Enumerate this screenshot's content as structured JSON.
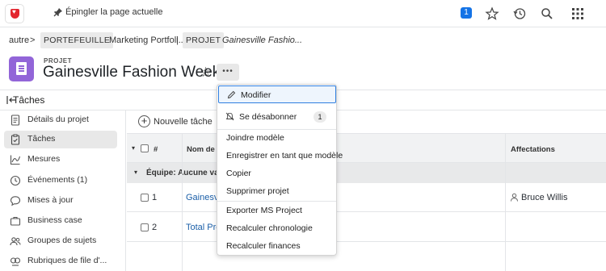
{
  "topbar": {
    "pin_label": "Épingler la page actuelle",
    "notification_count": "1"
  },
  "breadcrumb": {
    "root": "autre",
    "sep1": ">",
    "portfolio_tag": "PORTEFEUILLE",
    "portfolio_name": "Marketing Portfoli...",
    "sep2": "|",
    "project_tag": "PROJET",
    "project_name": "Gainesville Fashio..."
  },
  "header": {
    "type_label": "PROJET",
    "title": "Gainesville Fashion Week",
    "more_label": "•••"
  },
  "tasks_bar": {
    "label": "Tâches"
  },
  "sidebar": {
    "items": [
      {
        "label": "Détails du projet",
        "icon": "document-icon"
      },
      {
        "label": "Tâches",
        "icon": "clipboard-icon",
        "active": true
      },
      {
        "label": "Mesures",
        "icon": "chart-icon"
      },
      {
        "label": "Événements (1)",
        "icon": "clock-icon"
      },
      {
        "label": "Mises à jour",
        "icon": "chat-icon"
      },
      {
        "label": "Business case",
        "icon": "briefcase-icon"
      },
      {
        "label": "Groupes de sujets",
        "icon": "people-icon"
      },
      {
        "label": "Rubriques de file d'...",
        "icon": "queue-icon"
      }
    ]
  },
  "main": {
    "new_task": "Nouvelle tâche",
    "columns": {
      "num": "#",
      "name": "Nom de l",
      "assign": "Affectations"
    },
    "group_label": "Équipe: Aucune vale",
    "rows": [
      {
        "num": "1",
        "name": "Gainesvil",
        "assignee": "Bruce Willis"
      },
      {
        "num": "2",
        "name": "Total Proj",
        "assignee": ""
      }
    ]
  },
  "menu": {
    "items": [
      {
        "label": "Modifier",
        "icon": "pencil-icon"
      },
      {
        "label": "Se désabonner",
        "icon": "bell-icon",
        "count": "1"
      },
      {
        "label": "Joindre modèle"
      },
      {
        "label": "Enregistrer en tant que modèle"
      },
      {
        "label": "Copier"
      },
      {
        "label": "Supprimer projet"
      },
      {
        "label": "Exporter MS Project"
      },
      {
        "label": "Recalculer chronologie"
      },
      {
        "label": "Recalculer finances"
      }
    ]
  },
  "colors": {
    "accent": "#1473e6",
    "project_icon": "#9265d8",
    "link": "#1b5fa8",
    "logo": "#e3262f"
  }
}
